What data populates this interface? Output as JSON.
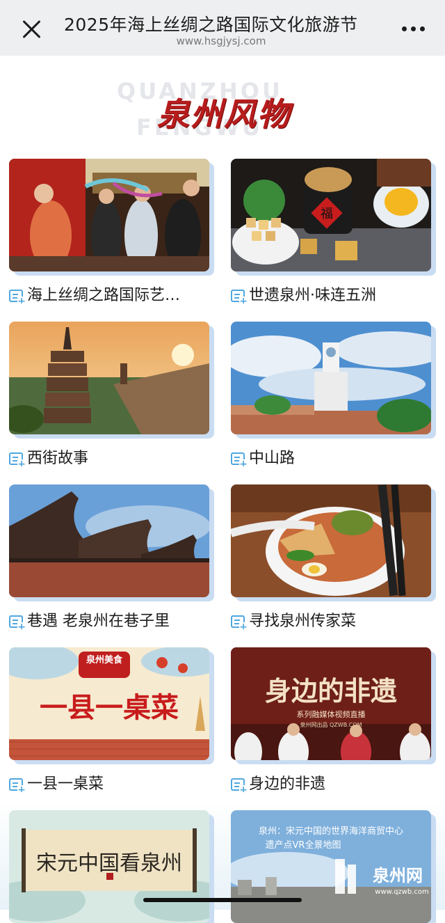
{
  "topbar": {
    "title": "2025年海上丝绸之路国际文化旅游节",
    "url": "www.hsgjysj.com"
  },
  "heading": {
    "main": "泉州风物",
    "ghost_line1": "QUANZHOU",
    "ghost_line2": "FENGWU"
  },
  "cards": [
    {
      "label": "海上丝绸之路国际艺…"
    },
    {
      "label": "世遗泉州·味连五洲",
      "overlay": "福"
    },
    {
      "label": "西街故事"
    },
    {
      "label": "中山路"
    },
    {
      "label": "巷遇 老泉州在巷子里"
    },
    {
      "label": "寻找泉州传家菜"
    },
    {
      "label": "一县一桌菜",
      "overlay": "一县一桌菜",
      "badge": "泉州美食"
    },
    {
      "label": "身边的非遗",
      "overlay": "身边的非遗",
      "sub": "系列融媒体视频直播",
      "small": "泉州网出品 QZWB.COM"
    },
    {
      "label": "",
      "overlay": "宋元中国看泉州"
    },
    {
      "label": "",
      "overlay": "泉州：宋元中国的世界海洋商贸中心",
      "overlay2": "遗产点VR全景地图",
      "logo": "泉州网",
      "logo_url": "www.qzwb.com"
    }
  ],
  "colors": {
    "accent": "#4fa7df",
    "heading_red": "#b71c1c",
    "card_shadow": "#c9dcf2"
  }
}
